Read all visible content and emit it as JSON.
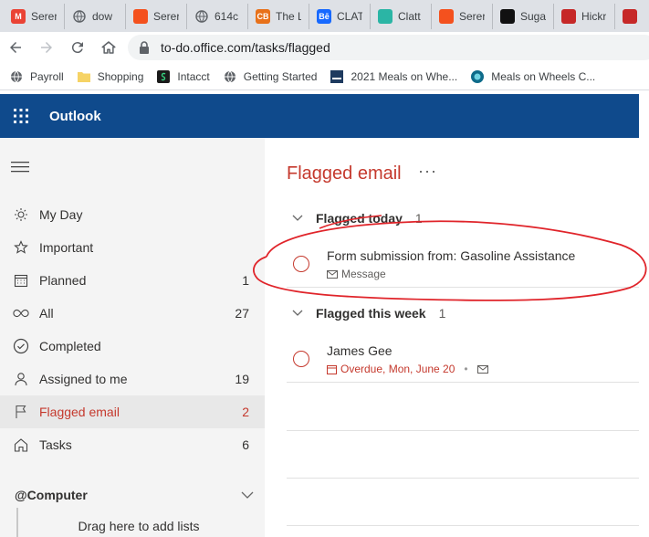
{
  "browser": {
    "tabs": [
      {
        "label": "Serer",
        "fav": "M",
        "color": "#ea4335"
      },
      {
        "label": "dow",
        "fav": "globe",
        "color": "#5f6368"
      },
      {
        "label": "Serer",
        "fav": "",
        "color": "#f4511e"
      },
      {
        "label": "614c",
        "fav": "globe",
        "color": "#5f6368"
      },
      {
        "label": "The L",
        "fav": "CB",
        "color": "#e8711a"
      },
      {
        "label": "CLAT",
        "fav": "Bē",
        "color": "#1769ff"
      },
      {
        "label": "Clatt",
        "fav": "",
        "color": "#2bb5a5"
      },
      {
        "label": "Serer",
        "fav": "",
        "color": "#f4511e"
      },
      {
        "label": "Suga",
        "fav": "",
        "color": "#111111"
      },
      {
        "label": "Hickr",
        "fav": "",
        "color": "#c62828"
      },
      {
        "label": "",
        "fav": "",
        "color": "#c62828"
      }
    ],
    "url": "to-do.office.com/tasks/flagged",
    "bookmarks": [
      {
        "label": "Payroll",
        "icon": "globe-icon"
      },
      {
        "label": "Shopping",
        "icon": "folder-icon"
      },
      {
        "label": "Intacct",
        "icon": "intacct-icon"
      },
      {
        "label": "Getting Started",
        "icon": "globe-icon"
      },
      {
        "label": "2021 Meals on Whe...",
        "icon": "meals-icon"
      },
      {
        "label": "Meals on Wheels C...",
        "icon": "meals-circle-icon"
      }
    ]
  },
  "app": {
    "brand": "Outlook",
    "accent": "#c5392d",
    "header_color": "#0f4a8c"
  },
  "sidebar": {
    "items": [
      {
        "key": "my-day",
        "label": "My Day",
        "count": ""
      },
      {
        "key": "important",
        "label": "Important",
        "count": ""
      },
      {
        "key": "planned",
        "label": "Planned",
        "count": "1"
      },
      {
        "key": "all",
        "label": "All",
        "count": "27"
      },
      {
        "key": "completed",
        "label": "Completed",
        "count": ""
      },
      {
        "key": "assigned",
        "label": "Assigned to me",
        "count": "19"
      },
      {
        "key": "flagged",
        "label": "Flagged email",
        "count": "2"
      },
      {
        "key": "tasks",
        "label": "Tasks",
        "count": "6"
      }
    ],
    "group": {
      "label": "@Computer"
    },
    "dropzone": "Drag here to add lists"
  },
  "main": {
    "title": "Flagged email",
    "more": "···",
    "sections": [
      {
        "label": "Flagged today",
        "count": "1"
      },
      {
        "label": "Flagged this week",
        "count": "1"
      }
    ],
    "tasks": [
      {
        "title": "Form submission from: Gasoline Assistance",
        "meta": "Message"
      },
      {
        "title": "James Gee",
        "meta": "Overdue, Mon, June 20"
      }
    ]
  }
}
